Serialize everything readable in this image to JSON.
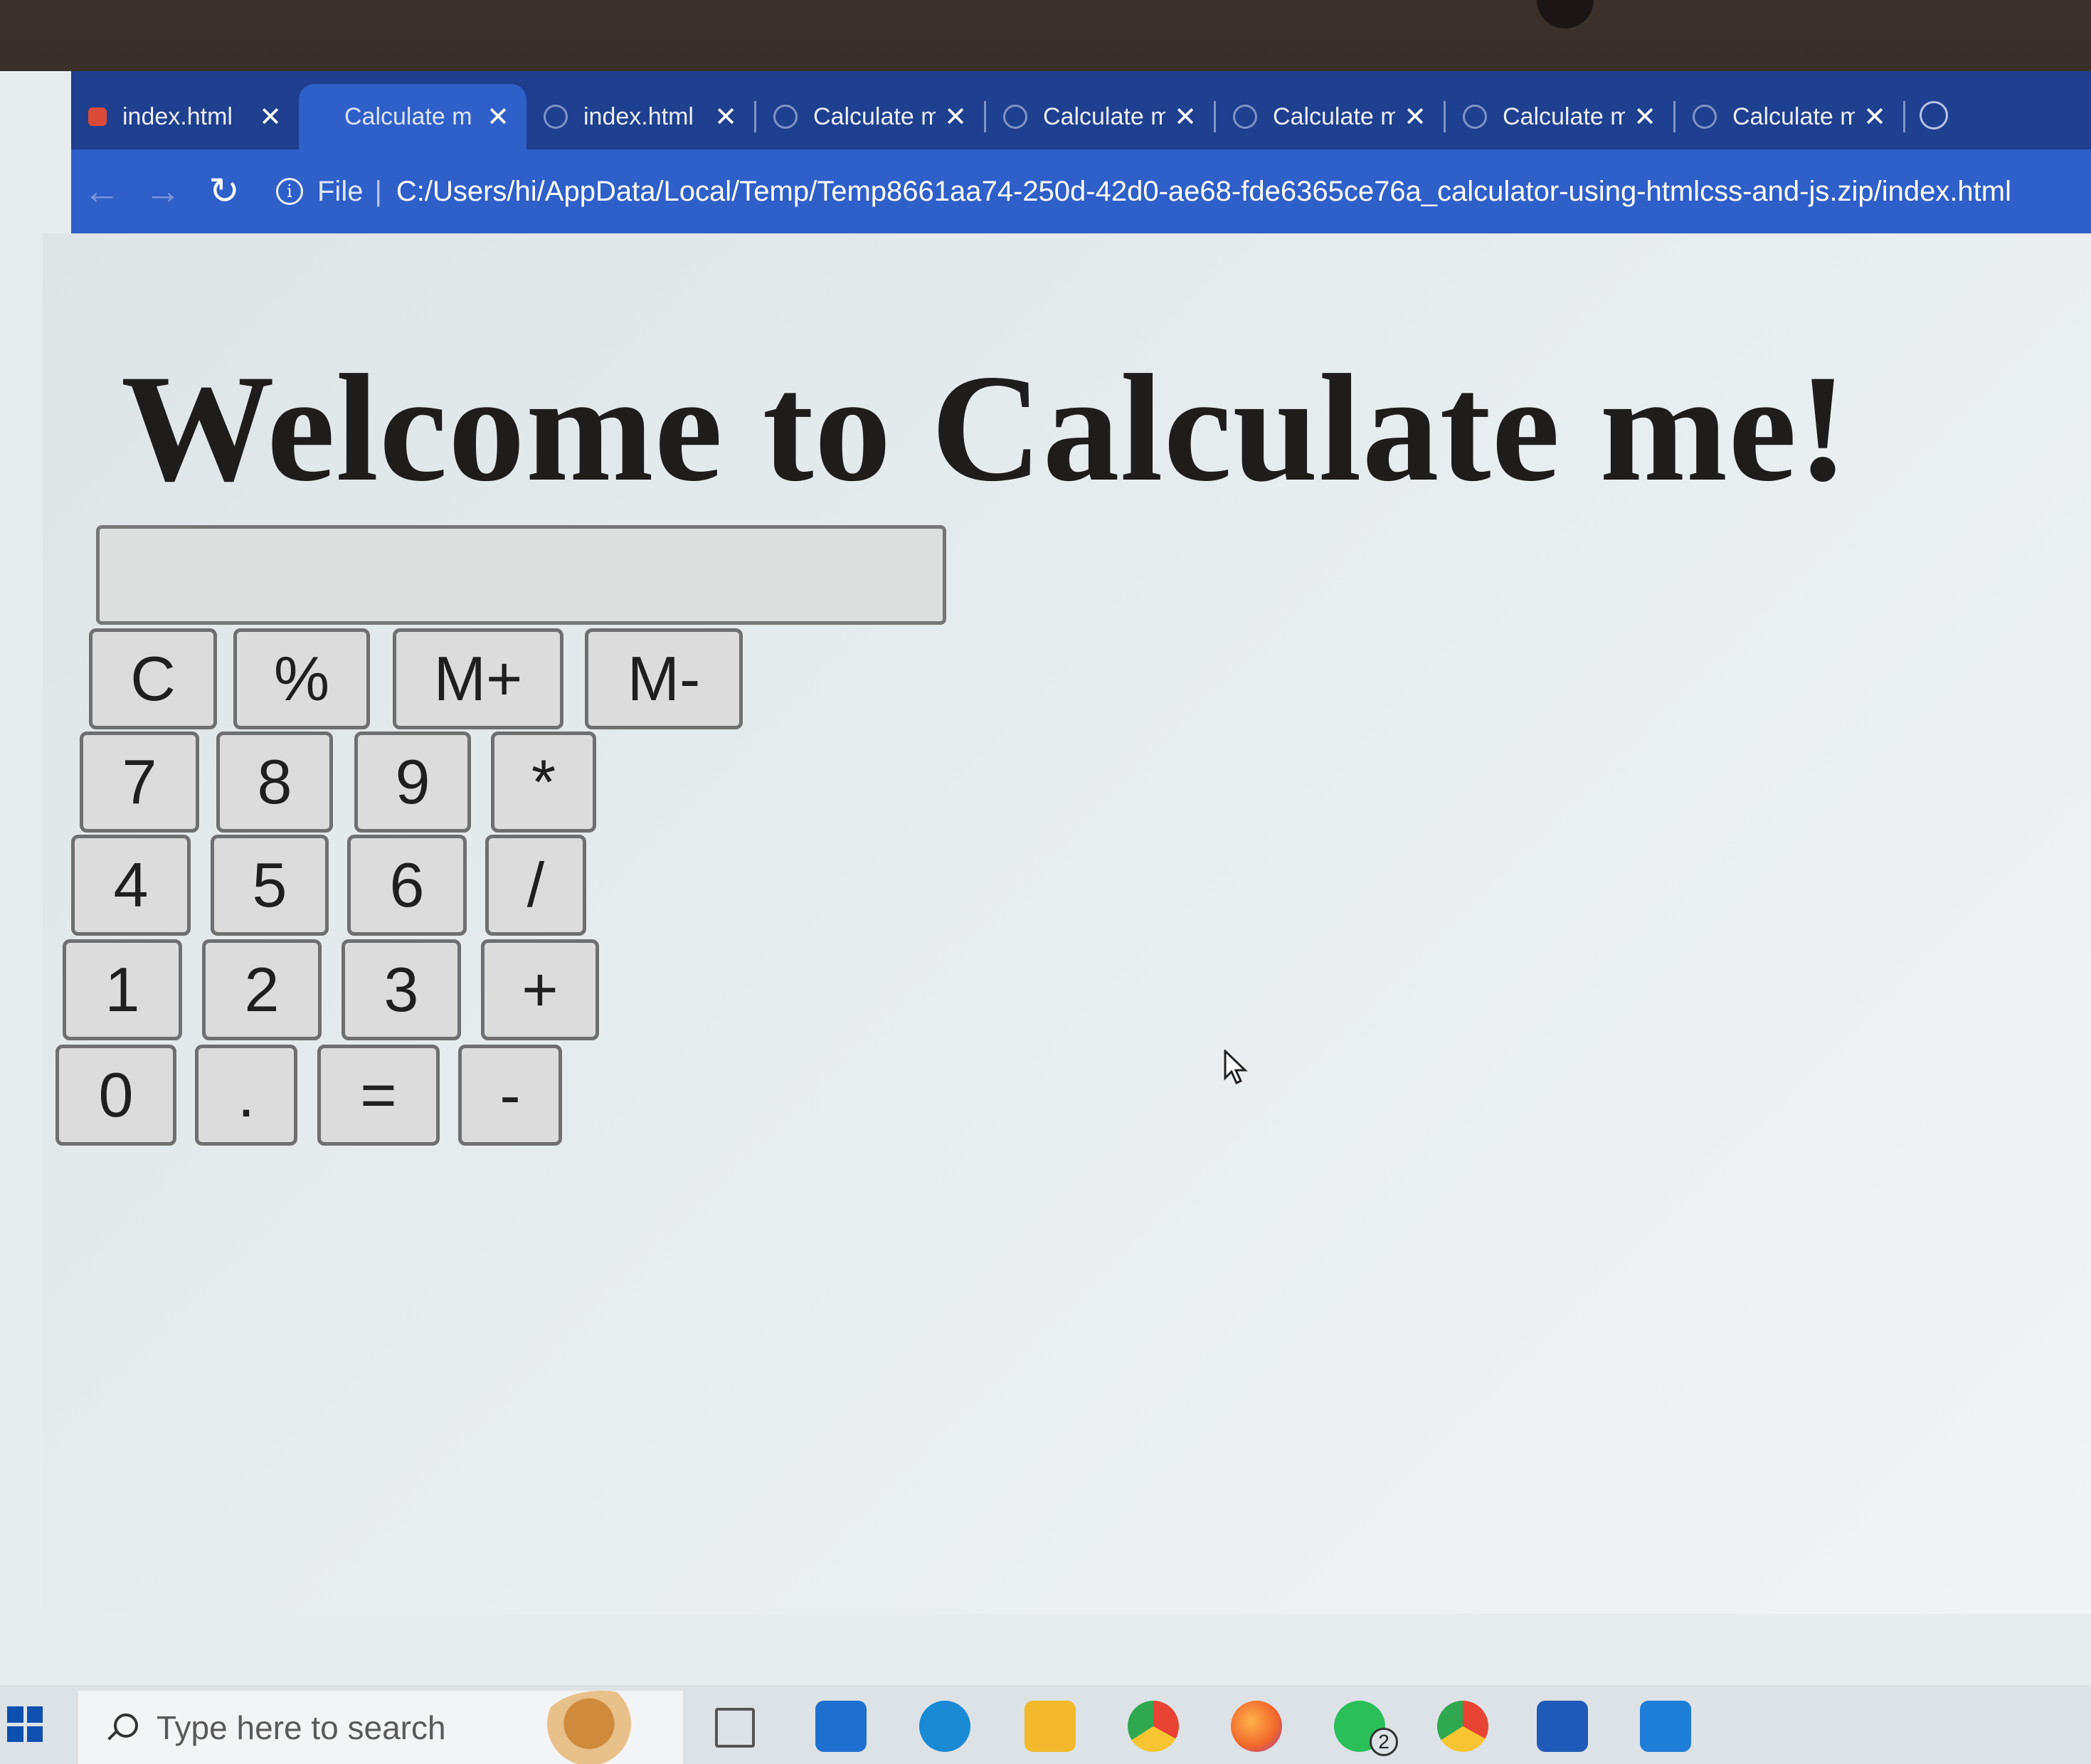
{
  "browser": {
    "tabs": [
      {
        "label": "index.html",
        "close": "✕",
        "favicon": "red-code-icon"
      },
      {
        "label": "Calculate m",
        "close": "✕",
        "favicon": "globe-icon",
        "active": true
      },
      {
        "label": "index.html",
        "close": "✕",
        "favicon": "globe-icon"
      },
      {
        "label": "Calculate m",
        "close": "✕",
        "favicon": "globe-icon"
      },
      {
        "label": "Calculate m",
        "close": "✕",
        "favicon": "globe-icon"
      },
      {
        "label": "Calculate m",
        "close": "✕",
        "favicon": "globe-icon"
      },
      {
        "label": "Calculate m",
        "close": "✕",
        "favicon": "globe-icon"
      },
      {
        "label": "Calculate m",
        "close": "✕",
        "favicon": "globe-icon"
      }
    ],
    "toolbar": {
      "back": "←",
      "forward": "→",
      "reload": "↻",
      "info": "i",
      "scheme_label": "File",
      "separator": "|",
      "url": "C:/Users/hi/AppData/Local/Temp/Temp8661aa74-250d-42d0-ae68-fde6365ce76a_calculator-using-htmlcss-and-js.zip/index.html"
    }
  },
  "page": {
    "title": "Welcome to Calculate me!",
    "display_value": "",
    "keys": {
      "clear": "C",
      "percent": "%",
      "mplus": "M+",
      "mminus": "M-",
      "k7": "7",
      "k8": "8",
      "k9": "9",
      "multiply": "*",
      "k4": "4",
      "k5": "5",
      "k6": "6",
      "divide": "/",
      "k1": "1",
      "k2": "2",
      "k3": "3",
      "plus": "+",
      "k0": "0",
      "dot": ".",
      "equals": "=",
      "minus": "-"
    }
  },
  "taskbar": {
    "search_placeholder": "Type here to search",
    "whatsapp_badge": "2",
    "colors": {
      "mail": "#1f6fd1",
      "edge": "#1a8ad4",
      "explorer": "#f2b92c",
      "chrome": "#e84434",
      "firefox": "#f0652a",
      "whatsapp": "#2bbf5a",
      "store": "#1f5ab8",
      "photos": "#1f7ed8"
    }
  }
}
